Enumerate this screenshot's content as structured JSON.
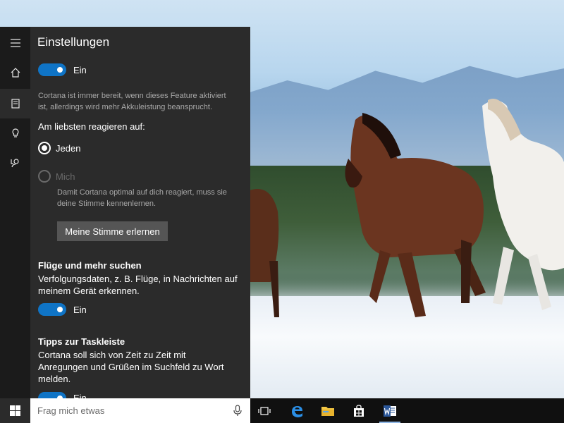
{
  "panel": {
    "title": "Einstellungen",
    "toggle_top_label": "Ein",
    "toggle_top_desc_line1": "Cortana ist immer bereit, wenn dieses Feature aktiviert",
    "toggle_top_desc_line2": "ist, allerdings wird mehr Akkuleistung beansprucht.",
    "react_heading": "Am liebsten reagieren auf:",
    "option_jeden": "Jeden",
    "option_mich": "Mich",
    "mich_desc_line1": "Damit Cortana optimal auf dich reagiert, muss sie",
    "mich_desc_line2": "deine Stimme kennenlernen.",
    "learn_voice_button": "Meine Stimme erlernen",
    "flights_heading": "Flüge und mehr suchen",
    "flights_desc_line1": "Verfolgungsdaten, z. B. Flüge, in Nachrichten auf",
    "flights_desc_line2": "meinem Gerät erkennen.",
    "flights_toggle_label": "Ein",
    "tips_heading": "Tipps zur Taskleiste",
    "tips_desc_line1": "Cortana soll sich von Zeit zu Zeit mit",
    "tips_desc_line2": "Anregungen und Grüßen im Suchfeld zu Wort",
    "tips_desc_line3": "melden.",
    "tips_toggle_label": "Ein"
  },
  "rail": {
    "items": [
      "menu-icon",
      "home-icon",
      "notebook-icon",
      "lightbulb-icon",
      "feedback-icon"
    ],
    "active": "notebook-icon"
  },
  "taskbar": {
    "search_placeholder": "Frag mich etwas",
    "apps": [
      "task-view-icon",
      "edge-icon",
      "file-explorer-icon",
      "store-icon",
      "word-icon"
    ]
  },
  "colors": {
    "accent": "#0f74c6",
    "panel_bg": "#2b2b2b",
    "rail_bg": "#1b1b1b",
    "taskbar_bg": "#101010"
  }
}
